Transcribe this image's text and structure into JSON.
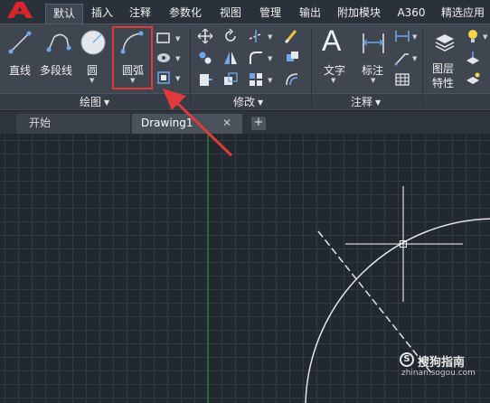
{
  "ribbon_tabs": [
    {
      "label": "默认",
      "active": true
    },
    {
      "label": "插入"
    },
    {
      "label": "注释"
    },
    {
      "label": "参数化"
    },
    {
      "label": "视图"
    },
    {
      "label": "管理"
    },
    {
      "label": "输出"
    },
    {
      "label": "附加模块"
    },
    {
      "label": "A360"
    },
    {
      "label": "精选应用"
    }
  ],
  "draw_panel": {
    "title": "绘图",
    "line_label": "直线",
    "polyline_label": "多段线",
    "circle_label": "圆",
    "arc_label": "圆弧"
  },
  "modify_panel": {
    "title": "修改"
  },
  "annotation_panel": {
    "title": "注释",
    "text_label": "文字",
    "dimension_label": "标注"
  },
  "layers_panel": {
    "label_line1": "图层",
    "label_line2": "特性"
  },
  "file_tabs": {
    "start_label": "开始",
    "drawing_label": "Drawing1",
    "close_glyph": "✕",
    "add_glyph": "+"
  },
  "watermark": {
    "name": "搜狗指南",
    "url": "zhinan.sogou.com",
    "logo_glyph": "S"
  },
  "colors": {
    "canvas_bg": "#212830",
    "grid_line": "#313944",
    "highlight": "#e03a3a",
    "axis_y": "#2f9b3a",
    "crosshair": "#ffffff",
    "icon_blue": "#6fa8e8"
  }
}
